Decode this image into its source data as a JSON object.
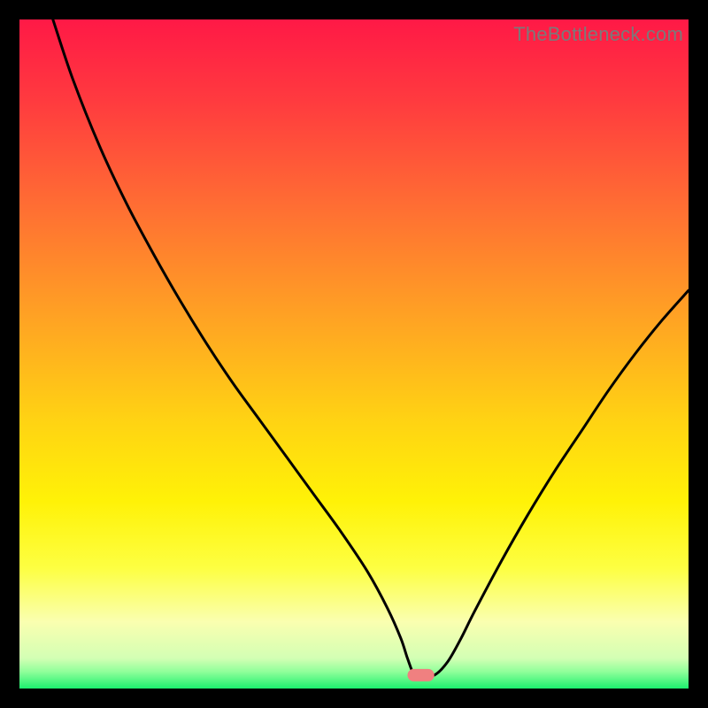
{
  "attribution": "TheBottleneck.com",
  "chart_data": {
    "type": "line",
    "title": "",
    "xlabel": "",
    "ylabel": "",
    "xlim": [
      0,
      100
    ],
    "ylim": [
      0,
      100
    ],
    "background_gradient_stops": [
      {
        "offset": 0.0,
        "color": "#ff1946"
      },
      {
        "offset": 0.12,
        "color": "#ff3a3f"
      },
      {
        "offset": 0.28,
        "color": "#ff6e33"
      },
      {
        "offset": 0.45,
        "color": "#ffa423"
      },
      {
        "offset": 0.6,
        "color": "#ffd313"
      },
      {
        "offset": 0.72,
        "color": "#fff207"
      },
      {
        "offset": 0.82,
        "color": "#fdff42"
      },
      {
        "offset": 0.9,
        "color": "#faffb0"
      },
      {
        "offset": 0.955,
        "color": "#d3ffb4"
      },
      {
        "offset": 0.975,
        "color": "#8fff9a"
      },
      {
        "offset": 1.0,
        "color": "#1cf06e"
      }
    ],
    "series": [
      {
        "name": "bottleneck-curve",
        "x": [
          5,
          8,
          12,
          16,
          20,
          24,
          28,
          32,
          36,
          40,
          44,
          48,
          52,
          55,
          57,
          58,
          59,
          60,
          62,
          64,
          66,
          68,
          72,
          76,
          80,
          84,
          88,
          92,
          96,
          100
        ],
        "y": [
          100,
          91,
          81,
          72.5,
          65,
          58,
          51.5,
          45.5,
          40,
          34.5,
          29,
          23.5,
          17.5,
          12,
          7.5,
          4.5,
          2,
          2,
          2,
          4,
          7.5,
          11.5,
          19,
          26,
          32.5,
          38.5,
          44.5,
          50,
          55,
          59.5
        ]
      }
    ],
    "marker": {
      "name": "optimal-range",
      "type": "pill",
      "x_range": [
        58,
        62
      ],
      "y": 2,
      "color": "#f08080"
    }
  }
}
